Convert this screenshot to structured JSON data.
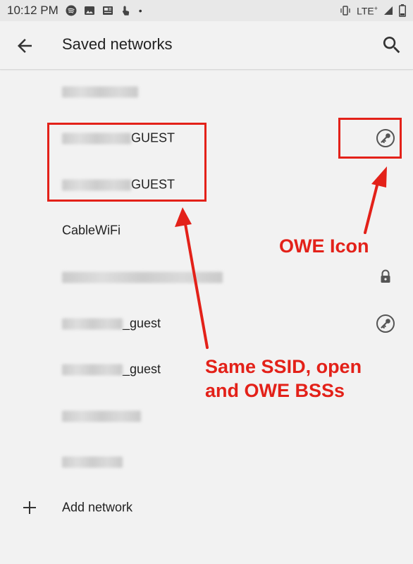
{
  "statusbar": {
    "time": "10:12 PM",
    "dot": "•",
    "network": "LTE"
  },
  "appbar": {
    "title": "Saved networks"
  },
  "networks": [
    {
      "name": "",
      "suffix": "",
      "icon": "none"
    },
    {
      "name": "",
      "suffix": "GUEST",
      "icon": "key-icon"
    },
    {
      "name": "",
      "suffix": "GUEST",
      "icon": "none"
    },
    {
      "name": "CableWiFi",
      "suffix": "",
      "icon": "none"
    },
    {
      "name": "",
      "suffix": "",
      "icon": "lock-icon"
    },
    {
      "name": "",
      "suffix": "_guest",
      "icon": "key-icon"
    },
    {
      "name": "",
      "suffix": "_guest",
      "icon": "none"
    },
    {
      "name": "",
      "suffix": "",
      "icon": "none"
    },
    {
      "name": "",
      "suffix": "",
      "icon": "none"
    }
  ],
  "add_network": {
    "label": "Add network"
  },
  "annotations": {
    "owe_icon": "OWE Icon",
    "same_ssid_line1": "Same SSID, open",
    "same_ssid_line2": "and OWE BSSs",
    "color": "#e32119"
  }
}
